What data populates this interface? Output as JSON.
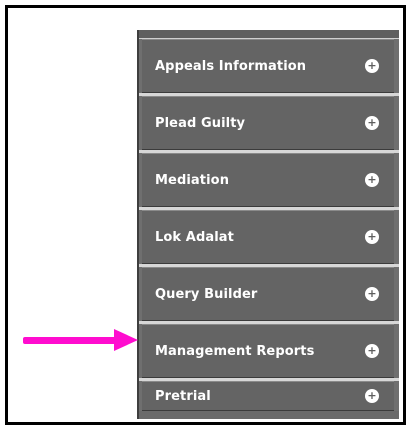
{
  "menu": {
    "items": [
      {
        "label": "Appeals Information",
        "icon": "plus-icon"
      },
      {
        "label": "Plead Guilty",
        "icon": "plus-icon"
      },
      {
        "label": "Mediation",
        "icon": "plus-icon"
      },
      {
        "label": "Lok Adalat",
        "icon": "plus-icon"
      },
      {
        "label": "Query Builder",
        "icon": "plus-icon"
      },
      {
        "label": "Management Reports",
        "icon": "plus-icon"
      },
      {
        "label": "Pretrial",
        "icon": "plus-icon"
      }
    ],
    "expand_glyph": "+"
  },
  "annotation": {
    "color": "#ff0ccf",
    "points_to": "Management Reports"
  },
  "colors": {
    "menu_background": "#646464",
    "divider": "#d7d7d7",
    "text": "#ffffff"
  }
}
